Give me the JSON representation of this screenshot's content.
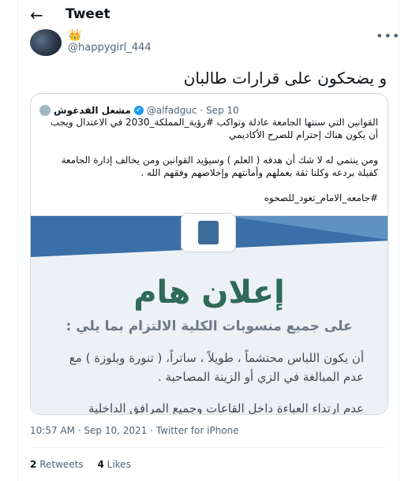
{
  "header": {
    "title": "Tweet",
    "back_icon": "arrow-left-icon"
  },
  "author": {
    "handle": "@happygirl_444",
    "badge": "👑"
  },
  "tweet": {
    "text": "و يضحكون على قرارات طالبان"
  },
  "quote": {
    "name": "مشعل القدغوش",
    "handle": "@alfadguc",
    "date": "Sep 10",
    "text_p1": "القوانين التي سنتها الجامعة عادلة وتواكب #رؤية_المملكة_2030 في الاعتدال ويجب أن يكون هناك إحترام للصرح الأكاديمي",
    "text_p2": "ومن ينتمي له لا شك أن هدفه ( العلم ) وسيؤيد القوانين ومن يخالف إدارة الجامعة كفيلة بردعه وكلنا ثقة بعملهم وأمانتهم وإخلاصهم وفقهم الله .",
    "hashtag": "#جامعه_الامام_تعود_للصحوه",
    "image": {
      "title": "إعلان هام",
      "subtitle": "على جميع منسوبات الكلية الالتزام بما يلي :",
      "bullet1": "أن يكون اللباس محتشماً ، طويلاً ، ساتراً، ( تنورة وبلوزة ) مع عدم المبالغة في الزي أو الزينة المصاحبة .",
      "bullet2": "عدم ارتداء العباءة داخل القاعات وجميع المرافق الداخلية للكلية."
    }
  },
  "meta": {
    "time": "10:57 AM · Sep 10, 2021 · Twitter for iPhone"
  },
  "stats": {
    "retweets_count": "2",
    "retweets_label": "Retweets",
    "likes_count": "4",
    "likes_label": "Likes"
  }
}
